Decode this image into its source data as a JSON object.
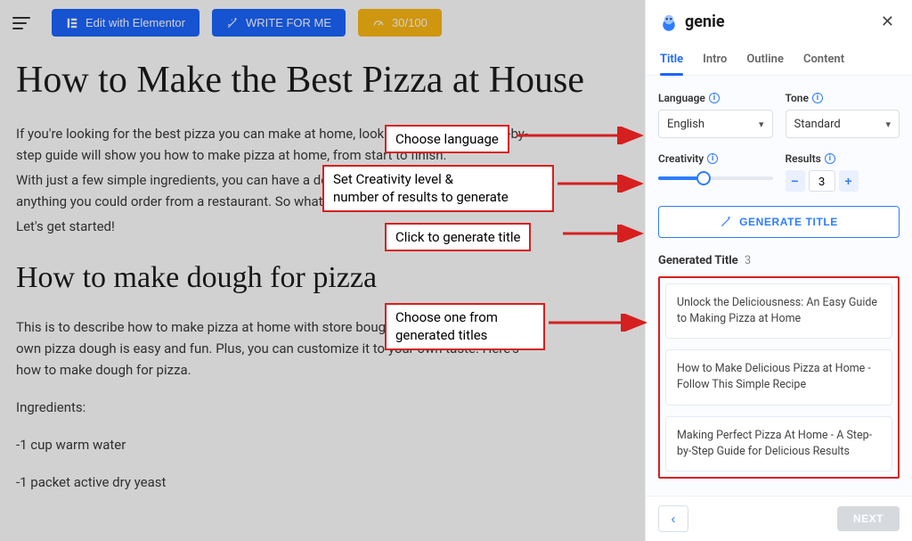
{
  "toolbar": {
    "edit_label": "Edit with Elementor",
    "write_label": "WRITE FOR ME",
    "score_label": "30/100"
  },
  "editor": {
    "title": "How to Make the Best Pizza at House",
    "p1": "If you're looking for the best pizza you can make at home, look no further! This step-by-step guide will show you how to make pizza at home, from start to finish.",
    "p2": "With just a few simple ingredients, you can have a delicious pizza that's better than anything you could order from a restaurant. So what are you waiting for?",
    "p3": "Let's get started!",
    "h2": "How to make dough for pizza",
    "p4": "This is to describe how to make pizza at home with store bought dough Making your own pizza dough is easy and fun. Plus, you can customize it to your own taste. Here's how to make dough for pizza.",
    "ing_label": "Ingredients:",
    "ing1": "-1 cup warm water",
    "ing2": "-1 packet active dry yeast"
  },
  "sidebar": {
    "brand": "genie",
    "tabs": {
      "title": "Title",
      "intro": "Intro",
      "outline": "Outline",
      "content": "Content"
    },
    "language_label": "Language",
    "language_value": "English",
    "tone_label": "Tone",
    "tone_value": "Standard",
    "creativity_label": "Creativity",
    "creativity_pct": 40,
    "results_label": "Results",
    "results_value": "3",
    "generate_label": "GENERATE TITLE",
    "generated_head": "Generated Title",
    "generated_count": "3",
    "titles": [
      "Unlock the Deliciousness: An Easy Guide to Making Pizza at Home",
      "How to Make Delicious Pizza at Home - Follow This Simple Recipe",
      "Making Perfect Pizza At Home - A Step-by-Step Guide for Delicious Results"
    ],
    "next_label": "NEXT"
  },
  "annotations": {
    "lang": "Choose language",
    "creativity": "Set Creativity level &\nnumber of results to generate",
    "generate": "Click to generate title",
    "choose": "Choose one from\ngenerated titles"
  },
  "colors": {
    "accent": "#1a66ff",
    "warn": "#fdb813",
    "anno": "#d61f1f"
  }
}
